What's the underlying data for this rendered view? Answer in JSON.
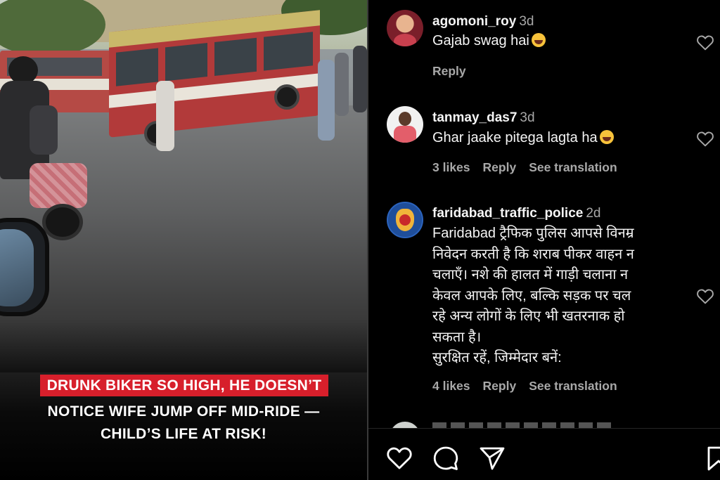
{
  "video": {
    "caption_line1": "DRUNK BIKER SO HIGH, HE DOESN’T",
    "caption_line2": "NOTICE WIFE JUMP OFF MID-RIDE —",
    "caption_line3": "CHILD’S LIFE AT RISK!",
    "caption_highlight_color": "#d71f2b"
  },
  "comments": [
    {
      "username": "agomoni_roy",
      "time": "3d",
      "text": "Gajab swag hai",
      "emoji": "grinning-squinting-face",
      "reply_label": "Reply"
    },
    {
      "username": "tanmay_das7",
      "time": "3d",
      "text": "Ghar jaake pitega lagta ha",
      "emoji": "grinning-squinting-face",
      "likes": "3 likes",
      "reply_label": "Reply",
      "translate_label": "See translation"
    },
    {
      "username": "faridabad_traffic_police",
      "time": "2d",
      "text_lines": [
        "Faridabad ट्रैफिक पुलिस आपसे विनम्र",
        "निवेदन करती है कि शराब पीकर वाहन न",
        "चलाएँ। नशे की हालत में गाड़ी चलाना न",
        "केवल आपके लिए, बल्कि सड़क पर चल",
        "रहे अन्य लोगों के लिए भी खतरनाक हो",
        "सकता है।",
        "सुरक्षित रहें, जिम्मेदार बनें:"
      ],
      "likes": "4 likes",
      "reply_label": "Reply",
      "translate_label": "See translation"
    }
  ],
  "actions": {
    "icons": [
      "heart-icon",
      "comment-icon",
      "share-icon",
      "bookmark-icon"
    ]
  },
  "colors": {
    "background": "#000000",
    "text_primary": "#f5f5f5",
    "text_secondary": "#a8a8a8"
  }
}
